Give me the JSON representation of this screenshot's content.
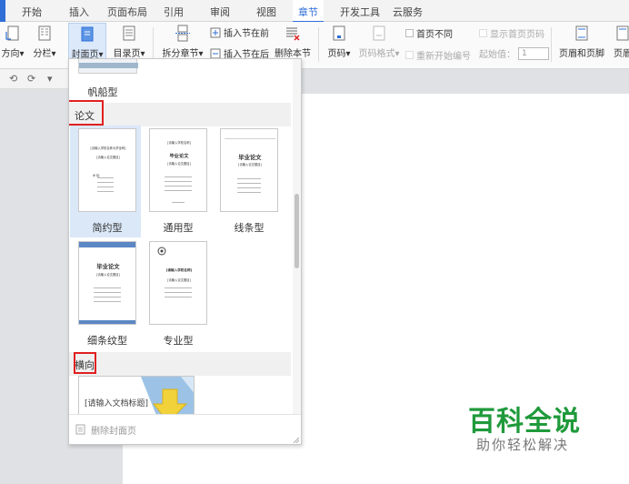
{
  "menu_tabs": [
    "开始",
    "插入",
    "页面布局",
    "引用",
    "审阅",
    "视图",
    "章节",
    "开发工具",
    "云服务"
  ],
  "active_tab": "章节",
  "ribbon": {
    "orientation_label": "方向",
    "columns_label": "分栏",
    "cover_label": "封面页",
    "toc_label": "目录页",
    "split_label": "拆分章节",
    "insert_before_label": "插入节在前",
    "insert_after_label": "插入节在后",
    "delete_section_label": "删除本节",
    "page_number_label": "页码",
    "page_number_format_label": "页码格式",
    "first_page_diff_label": "首页不同",
    "show_first_page_number_label": "显示首页页码",
    "restart_numbering_label": "重新开始编号",
    "start_value_label": "起始值：",
    "start_value": "1",
    "header_footer_label": "页眉和页脚",
    "header_label": "页眉"
  },
  "cover_panel": {
    "prev_item_label": "帆船型",
    "sections": [
      {
        "title": "论文",
        "items": [
          {
            "label": "简约型",
            "preview": {
              "title_line": "[请输入学校名称大学全称]",
              "subtitle": "[请输入论文题目]",
              "field_prefix": "学 院："
            }
          },
          {
            "label": "通用型",
            "preview": {
              "title_line": "[请输入学校名称]",
              "subtitle": "毕业论文",
              "subtitle2": "[请输入论文题目]"
            }
          },
          {
            "label": "线条型",
            "preview": {
              "title_line": "毕业论文",
              "subtitle": "[请输入论文题目]"
            }
          },
          {
            "label": "细条纹型",
            "preview": {
              "title_line": "毕业论文",
              "subtitle": "[请输入论文题目]"
            }
          },
          {
            "label": "专业型",
            "preview": {
              "title_line": "[请输入学校名称]",
              "subtitle": "[请输入论文题目]"
            }
          }
        ]
      },
      {
        "title": "横向",
        "items": [
          {
            "label": "",
            "preview": {
              "title_line": "[请输入文档标题]"
            }
          }
        ]
      }
    ],
    "delete_cover_label": "删除封面页"
  },
  "quick_access": [
    "⟲",
    "⟳",
    "▾"
  ],
  "watermark": {
    "title": "百科全说",
    "subtitle": "助你轻松解决"
  },
  "colors": {
    "accent": "#2f6fd6",
    "highlight_red": "#e02020",
    "watermark_green": "#1f9a3b"
  }
}
